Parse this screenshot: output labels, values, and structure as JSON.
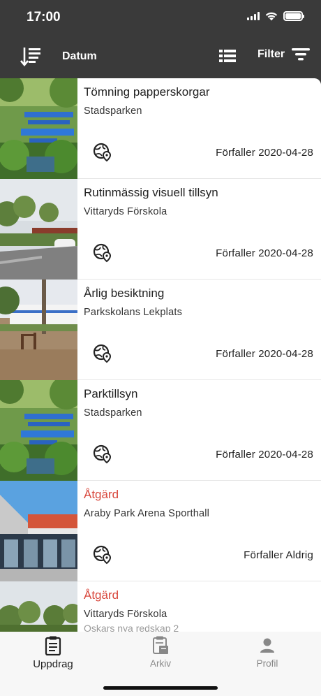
{
  "status_bar": {
    "time": "17:00"
  },
  "nav": {
    "sort_icon": "sort-descending-icon",
    "sort_label": "Datum",
    "list_view_icon": "list-view-icon",
    "filter_label": "Filter",
    "filter_icon": "filter-icon"
  },
  "tasks": [
    {
      "title": "Tömning papperskorgar",
      "place": "Stadsparken",
      "due": "Förfaller 2020-04-28",
      "photo": "park-fountain"
    },
    {
      "title": "Rutinmässig visuell tillsyn",
      "place": "Vittaryds Förskola",
      "due": "Förfaller 2020-04-28",
      "photo": "preschool-parking"
    },
    {
      "title": "Årlig besiktning",
      "place": "Parkskolans Lekplats",
      "due": "Förfaller 2020-04-28",
      "photo": "playground"
    },
    {
      "title": "Parktillsyn",
      "place": "Stadsparken",
      "due": "Förfaller 2020-04-28",
      "photo": "park-fountain"
    },
    {
      "title": "Åtgärd",
      "place": "Araby Park Arena Sporthall",
      "due": "Förfaller Aldrig",
      "photo": "sports-hall",
      "title_color": "#d8473c"
    },
    {
      "title": "Åtgärd",
      "place": "Vittaryds Förskola",
      "subtitle": "Oskars nya redskap 2",
      "photo": "preschool-trees",
      "title_color": "#d8473c"
    }
  ],
  "tabs": [
    {
      "label": "Uppdrag",
      "icon": "clipboard-icon",
      "active": true
    },
    {
      "label": "Arkiv",
      "icon": "archive-icon",
      "active": false
    },
    {
      "label": "Profil",
      "icon": "person-icon",
      "active": false
    }
  ],
  "colors": {
    "header": "#3a3a3a",
    "action": "#d8473c",
    "background": "#ffffff",
    "tab_bar": "#f7f7f7"
  }
}
